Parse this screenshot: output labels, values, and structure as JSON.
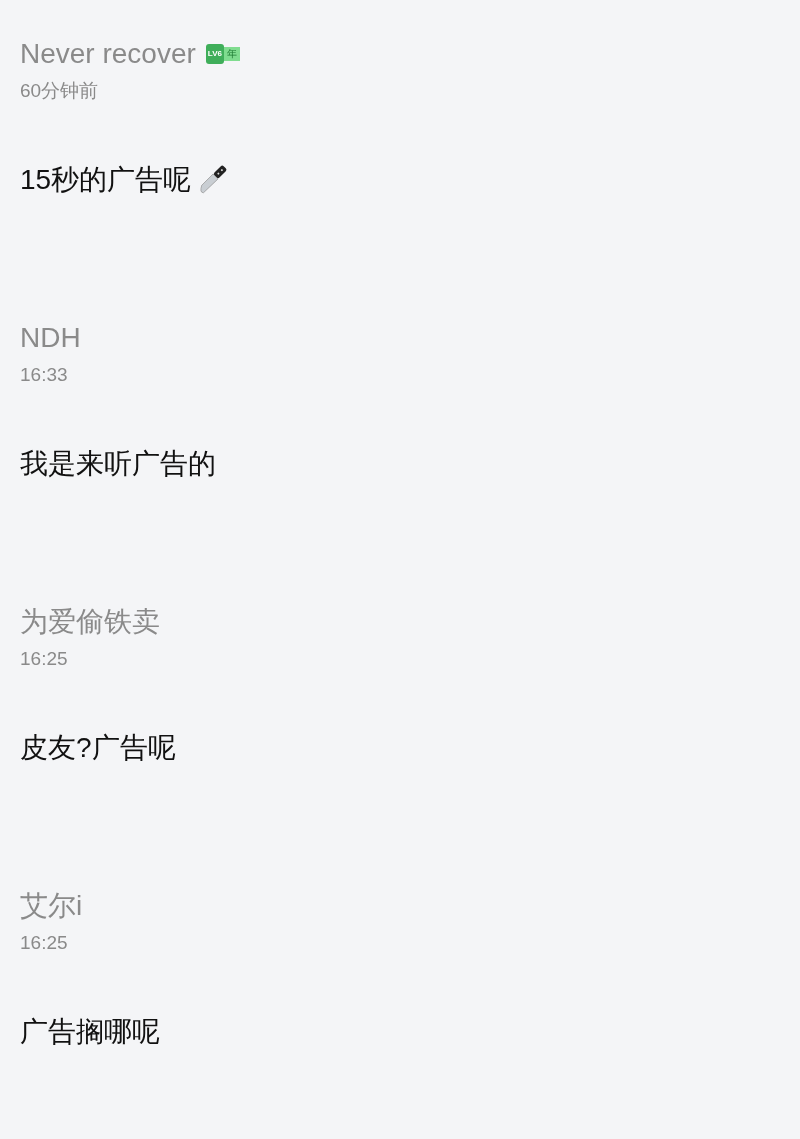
{
  "comments": [
    {
      "kind": "knife",
      "author": "Never recover",
      "badge": {
        "level": "LV6",
        "tag": "年"
      },
      "time": "60分钟前",
      "text": "15秒的广告呢"
    },
    {
      "kind": "plain",
      "author": "NDH",
      "time": "16:33",
      "text": "我是来听广告的"
    },
    {
      "kind": "plain",
      "author": "为爱偷铁卖",
      "time": "16:25",
      "text": "皮友?广告呢"
    },
    {
      "kind": "plain",
      "author": "艾尔i",
      "time": "16:25",
      "text": "广告搁哪呢"
    }
  ]
}
